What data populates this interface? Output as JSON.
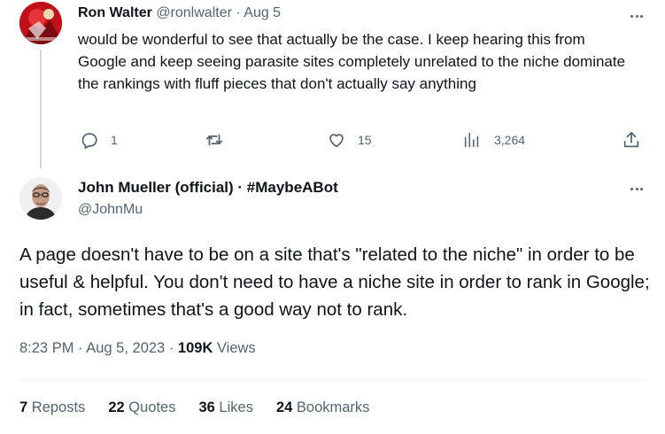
{
  "reply": {
    "name": "Ron Walter",
    "handle": "@ronlwalter",
    "separator": "·",
    "date": "Aug 5",
    "text": "would be wonderful to see that actually be the case. I keep hearing this from Google and keep seeing parasite sites completely unrelated to the niche dominate the rankings with fluff pieces that don't actually say anything",
    "actions": {
      "replies": "1",
      "retweets": "",
      "likes": "15",
      "views": "3,264"
    }
  },
  "main": {
    "name": "John Mueller (official) · #MaybeABot",
    "handle": "@JohnMu",
    "text": "A page doesn't have to be on a site that's \"related to the niche\" in order to be useful & helpful. You don't need to have a niche site in order to rank in Google; in fact, sometimes that's a good way not to rank.",
    "time": "8:23 PM",
    "date": "Aug 5, 2023",
    "sep1": "·",
    "sep2": "·",
    "views_count": "109K",
    "views_label": "Views",
    "stats": {
      "reposts_count": "7",
      "reposts_label": "Reposts",
      "quotes_count": "22",
      "quotes_label": "Quotes",
      "likes_count": "36",
      "likes_label": "Likes",
      "bookmarks_count": "24",
      "bookmarks_label": "Bookmarks"
    }
  },
  "colors": {
    "text_primary": "#0f1419",
    "text_secondary": "#536471",
    "divider": "#eff3f4",
    "thread_line": "#cfd9de"
  },
  "icons": [
    "more-icon",
    "reply-icon",
    "retweet-icon",
    "like-icon",
    "views-icon",
    "share-icon"
  ]
}
